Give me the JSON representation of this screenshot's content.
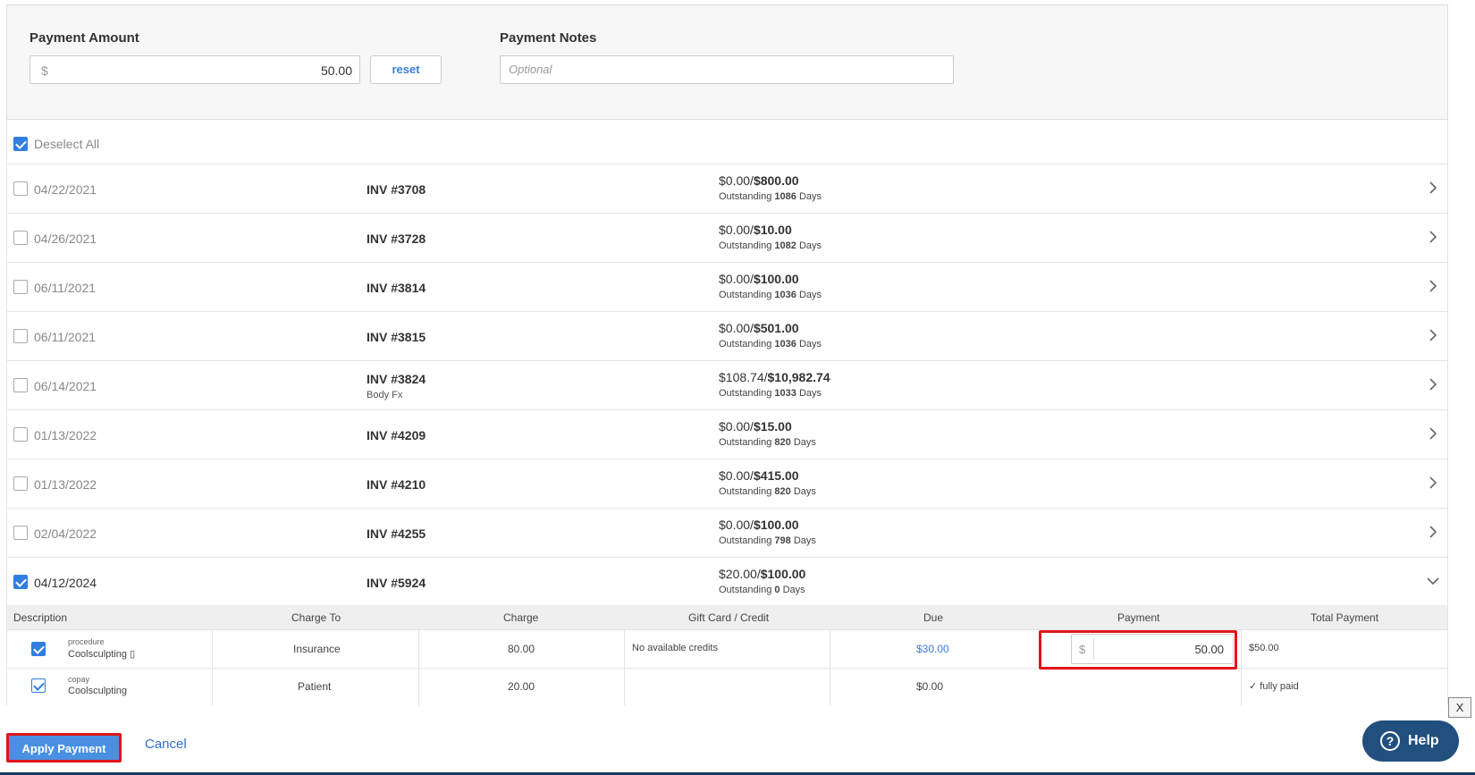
{
  "payment": {
    "amount_label": "Payment Amount",
    "currency": "$",
    "amount_value": "50.00",
    "reset_label": "reset",
    "notes_label": "Payment Notes",
    "notes_placeholder": "Optional"
  },
  "list": {
    "deselect_label": "Deselect All",
    "invoices": [
      {
        "date": "04/22/2021",
        "inv": "INV #3708",
        "sub": "",
        "paid": "$0.00/",
        "total": "$800.00",
        "outstanding_prefix": "Outstanding",
        "days": "1086",
        "days_suffix": "Days",
        "checked": false
      },
      {
        "date": "04/26/2021",
        "inv": "INV #3728",
        "sub": "",
        "paid": "$0.00/",
        "total": "$10.00",
        "outstanding_prefix": "Outstanding",
        "days": "1082",
        "days_suffix": "Days",
        "checked": false
      },
      {
        "date": "06/11/2021",
        "inv": "INV #3814",
        "sub": "",
        "paid": "$0.00/",
        "total": "$100.00",
        "outstanding_prefix": "Outstanding",
        "days": "1036",
        "days_suffix": "Days",
        "checked": false
      },
      {
        "date": "06/11/2021",
        "inv": "INV #3815",
        "sub": "",
        "paid": "$0.00/",
        "total": "$501.00",
        "outstanding_prefix": "Outstanding",
        "days": "1036",
        "days_suffix": "Days",
        "checked": false
      },
      {
        "date": "06/14/2021",
        "inv": "INV #3824",
        "sub": "Body Fx",
        "paid": "$108.74/",
        "total": "$10,982.74",
        "outstanding_prefix": "Outstanding",
        "days": "1033",
        "days_suffix": "Days",
        "checked": false
      },
      {
        "date": "01/13/2022",
        "inv": "INV #4209",
        "sub": "",
        "paid": "$0.00/",
        "total": "$15.00",
        "outstanding_prefix": "Outstanding",
        "days": "820",
        "days_suffix": "Days",
        "checked": false
      },
      {
        "date": "01/13/2022",
        "inv": "INV #4210",
        "sub": "",
        "paid": "$0.00/",
        "total": "$415.00",
        "outstanding_prefix": "Outstanding",
        "days": "820",
        "days_suffix": "Days",
        "checked": false
      },
      {
        "date": "02/04/2022",
        "inv": "INV #4255",
        "sub": "",
        "paid": "$0.00/",
        "total": "$100.00",
        "outstanding_prefix": "Outstanding",
        "days": "798",
        "days_suffix": "Days",
        "checked": false
      },
      {
        "date": "04/12/2024",
        "inv": "INV #5924",
        "sub": "",
        "paid": "$20.00/",
        "total": "$100.00",
        "outstanding_prefix": "Outstanding",
        "days": "0",
        "days_suffix": "Days",
        "checked": true
      }
    ]
  },
  "detail": {
    "headers": {
      "description": "Description",
      "charge_to": "Charge To",
      "charge": "Charge",
      "gift_card": "Gift Card / Credit",
      "due": "Due",
      "payment": "Payment",
      "total_payment": "Total Payment"
    },
    "rows": [
      {
        "type": "procedure",
        "name": "Coolsculpting ▯",
        "charge_to": "Insurance",
        "charge": "80.00",
        "credit": "No available credits",
        "due": "$30.00",
        "payment_currency": "$",
        "payment_value": "50.00",
        "total_payment": "$50.00"
      },
      {
        "type": "copay",
        "name": "Coolsculpting",
        "charge_to": "Patient",
        "charge": "20.00",
        "credit": "",
        "due": "$0.00",
        "total_payment": "✓ fully paid"
      }
    ]
  },
  "footer": {
    "apply_label": "Apply Payment",
    "cancel_label": "Cancel",
    "close_label": "X",
    "help_label": "Help",
    "help_icon_glyph": "?"
  },
  "colors": {
    "accent": "#2f7fe0",
    "apply_button": "#4a90e2",
    "highlight_red": "#e0161b",
    "help_button": "#22507e"
  }
}
